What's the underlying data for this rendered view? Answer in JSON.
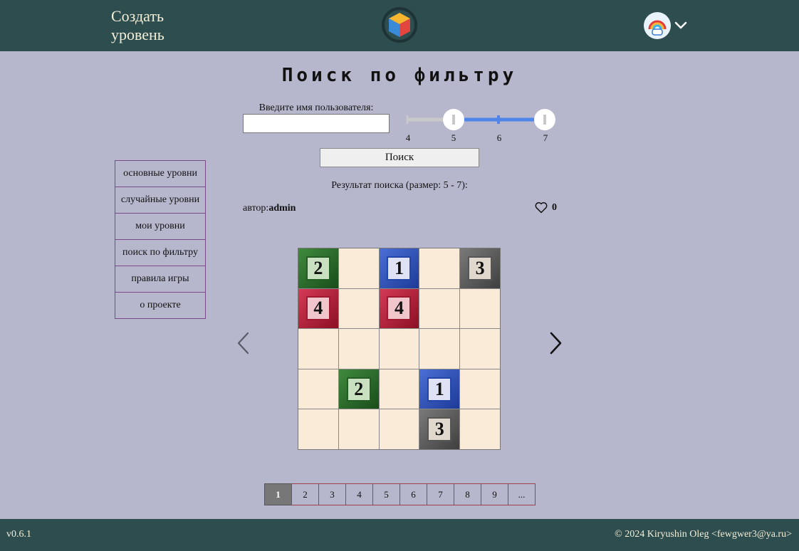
{
  "header": {
    "create_level": "Создать уровень",
    "logo_icon": "cube-logo-icon",
    "avatar_icon": "rainbow-avatar-icon",
    "menu_icon": "chevron-down-icon"
  },
  "page_title": "Поиск по фильтру",
  "search": {
    "username_label": "Введите имя пользователя:",
    "username_value": "",
    "size_range": {
      "min": 4,
      "max": 7,
      "selected_from": 5,
      "selected_to": 7
    },
    "ticks": [
      "4",
      "5",
      "6",
      "7"
    ],
    "button_label": "Поиск"
  },
  "result": {
    "summary": "Результат поиска (размер: 5 - 7):",
    "author_prefix": "автор:",
    "author_name": "admin",
    "likes": "0",
    "like_icon": "heart-icon"
  },
  "sidenav": {
    "items": [
      "основные уровни",
      "случайные уровни",
      "мои уровни",
      "поиск по фильтру",
      "правила игры",
      "о проекте"
    ]
  },
  "board": {
    "size": 5,
    "cells": [
      [
        {
          "v": "2",
          "c": "green"
        },
        null,
        {
          "v": "1",
          "c": "blue"
        },
        null,
        {
          "v": "3",
          "c": "gray"
        }
      ],
      [
        {
          "v": "4",
          "c": "red"
        },
        null,
        {
          "v": "4",
          "c": "red"
        },
        null,
        null
      ],
      [
        null,
        null,
        null,
        null,
        null
      ],
      [
        null,
        {
          "v": "2",
          "c": "green"
        },
        null,
        {
          "v": "1",
          "c": "blue"
        },
        null
      ],
      [
        null,
        null,
        null,
        {
          "v": "3",
          "c": "gray"
        },
        null
      ]
    ]
  },
  "navigation": {
    "prev_icon": "chevron-left-icon",
    "next_icon": "chevron-right-icon"
  },
  "pagination": {
    "pages": [
      "1",
      "2",
      "3",
      "4",
      "5",
      "6",
      "7",
      "8",
      "9",
      "..."
    ],
    "active": "1"
  },
  "footer": {
    "version": "v0.6.1",
    "copyright": "© 2024 Kiryushin Oleg <fewgwer3@ya.ru>"
  },
  "colors": {
    "header_bg": "#2d4d4f",
    "page_bg": "#b6b7cc",
    "board_cell": "#faebd9",
    "slider_active": "#4f84e8",
    "tile_green": "#2f6f2e",
    "tile_blue": "#2d51c0",
    "tile_gray": "#5a5a5a",
    "tile_red": "#b31d38"
  }
}
